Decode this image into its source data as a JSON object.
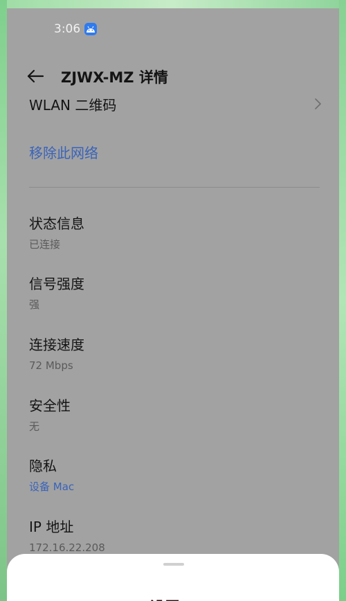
{
  "status_bar": {
    "time": "3:06",
    "app_icon": "android-icon"
  },
  "header": {
    "back_icon": "back-arrow-icon",
    "title": "ZJWX-MZ 详情"
  },
  "qr_row": {
    "label": "WLAN 二维码",
    "chevron_icon": "chevron-right-icon"
  },
  "remove_network": {
    "label": "移除此网络"
  },
  "details": [
    {
      "title": "状态信息",
      "value": "已连接"
    },
    {
      "title": "信号强度",
      "value": "强"
    },
    {
      "title": "连接速度",
      "value": "72 Mbps"
    },
    {
      "title": "安全性",
      "value": "无"
    },
    {
      "title": "隐私",
      "value": "设备 Mac"
    },
    {
      "title": "IP 地址",
      "value": "172.16.22.208"
    }
  ],
  "bottom_sheet": {
    "title": "设置"
  },
  "colors": {
    "accent_blue": "#3a63b9",
    "overlay_gray": "#a2a2a2",
    "sheet_bg": "#ffffff"
  }
}
